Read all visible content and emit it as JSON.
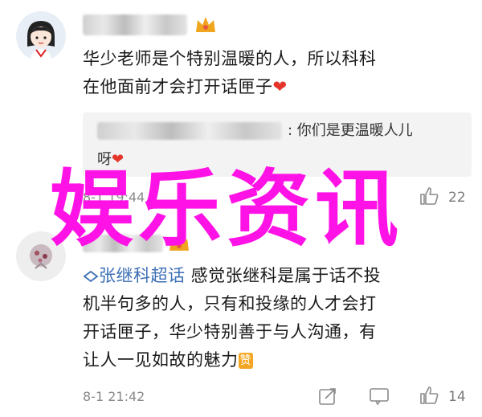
{
  "comment1": {
    "text_line1": "华少老师是个特别温暖的人，所以科科",
    "text_line2": "在他面前才会打开话匣子",
    "heart": "❤",
    "quote_line1": ": 你们是更温暖人儿",
    "quote_line2": "呀",
    "quote_heart": "❤",
    "time_partial": "8-1 19:44",
    "like_count": "22"
  },
  "overlay": {
    "title": "娱乐资讯"
  },
  "comment2": {
    "topic": "张继科超话",
    "text_line1_rest": " 感觉张继科是属于话不投",
    "text_line2": "机半句多的人，只有和投缘的人才会打",
    "text_line3": "开话匣子，华少特别善于与人沟通，有",
    "text_line4": "让人一见如故的魅力",
    "badge": "赞",
    "time": "8-1 21:42",
    "like_count": "14"
  },
  "colors": {
    "overlay": "#ff12e6",
    "topic": "#3b6fb6",
    "heart": "#e5352b",
    "crown": "#f0a51e"
  },
  "icons": [
    "crown-icon",
    "heart-icon",
    "share-icon",
    "comment-icon",
    "like-icon",
    "topic-icon"
  ]
}
